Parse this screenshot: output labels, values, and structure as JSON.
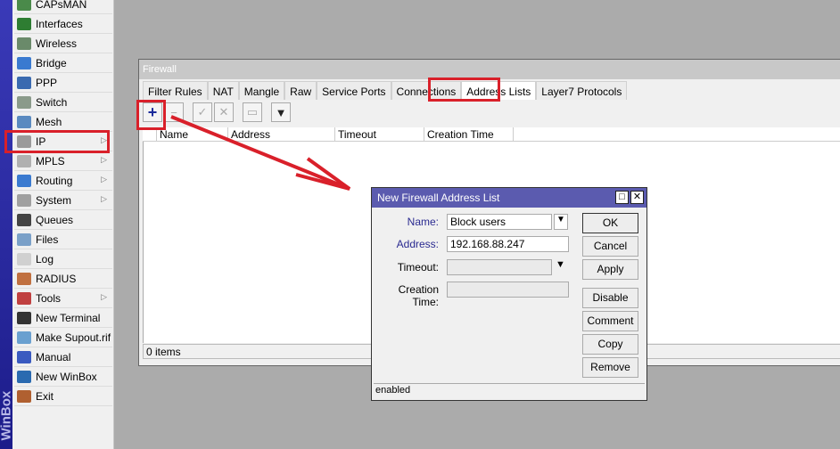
{
  "app": {
    "brand": "WinBox"
  },
  "sidebar": {
    "items": [
      {
        "label": "CAPsMAN",
        "icon": "antenna-icon",
        "color": "#4a8a4a",
        "submenu": false
      },
      {
        "label": "Interfaces",
        "icon": "interfaces-icon",
        "color": "#2e7d32",
        "submenu": false
      },
      {
        "label": "Wireless",
        "icon": "wireless-icon",
        "color": "#6a8a6a",
        "submenu": false
      },
      {
        "label": "Bridge",
        "icon": "bridge-icon",
        "color": "#3a7ad0",
        "submenu": false
      },
      {
        "label": "PPP",
        "icon": "ppp-icon",
        "color": "#3a6ab0",
        "submenu": false
      },
      {
        "label": "Switch",
        "icon": "switch-icon",
        "color": "#8a9a8a",
        "submenu": false
      },
      {
        "label": "Mesh",
        "icon": "mesh-icon",
        "color": "#5a8ac0",
        "submenu": false
      },
      {
        "label": "IP",
        "icon": "ip-icon",
        "color": "#9a9a9a",
        "submenu": true
      },
      {
        "label": "MPLS",
        "icon": "mpls-icon",
        "color": "#b0b0b0",
        "submenu": true
      },
      {
        "label": "Routing",
        "icon": "routing-icon",
        "color": "#3a7ad0",
        "submenu": true
      },
      {
        "label": "System",
        "icon": "gear-icon",
        "color": "#a0a0a0",
        "submenu": true
      },
      {
        "label": "Queues",
        "icon": "queues-icon",
        "color": "#444444",
        "submenu": false
      },
      {
        "label": "Files",
        "icon": "folder-icon",
        "color": "#7aa0c8",
        "submenu": false
      },
      {
        "label": "Log",
        "icon": "log-icon",
        "color": "#d0d0d0",
        "submenu": false
      },
      {
        "label": "RADIUS",
        "icon": "radius-icon",
        "color": "#c07040",
        "submenu": false
      },
      {
        "label": "Tools",
        "icon": "tools-icon",
        "color": "#c04040",
        "submenu": true
      },
      {
        "label": "New Terminal",
        "icon": "terminal-icon",
        "color": "#333333",
        "submenu": false
      },
      {
        "label": "Make Supout.rif",
        "icon": "supout-icon",
        "color": "#6aa0d0",
        "submenu": false
      },
      {
        "label": "Manual",
        "icon": "help-icon",
        "color": "#3a5ac0",
        "submenu": false
      },
      {
        "label": "New WinBox",
        "icon": "winbox-icon",
        "color": "#2a6ab0",
        "submenu": false
      },
      {
        "label": "Exit",
        "icon": "exit-icon",
        "color": "#b06030",
        "submenu": false
      }
    ]
  },
  "firewall": {
    "title": "Firewall",
    "tabs": [
      "Filter Rules",
      "NAT",
      "Mangle",
      "Raw",
      "Service Ports",
      "Connections",
      "Address Lists",
      "Layer7 Protocols"
    ],
    "active_tab": "Address Lists",
    "columns": [
      "Name",
      "Address",
      "Timeout",
      "Creation Time"
    ],
    "status": "0 items"
  },
  "dialog": {
    "title": "New Firewall Address List",
    "name_label": "Name:",
    "name_value": "Block users",
    "address_label": "Address:",
    "address_value": "192.168.88.247",
    "timeout_label": "Timeout:",
    "timeout_value": "",
    "creation_label": "Creation Time:",
    "creation_value": "",
    "buttons": [
      "OK",
      "Cancel",
      "Apply",
      "Disable",
      "Comment",
      "Copy",
      "Remove"
    ],
    "status": "enabled"
  },
  "colors": {
    "highlight": "#d9202a",
    "dialog_title": "#5b5baf"
  }
}
